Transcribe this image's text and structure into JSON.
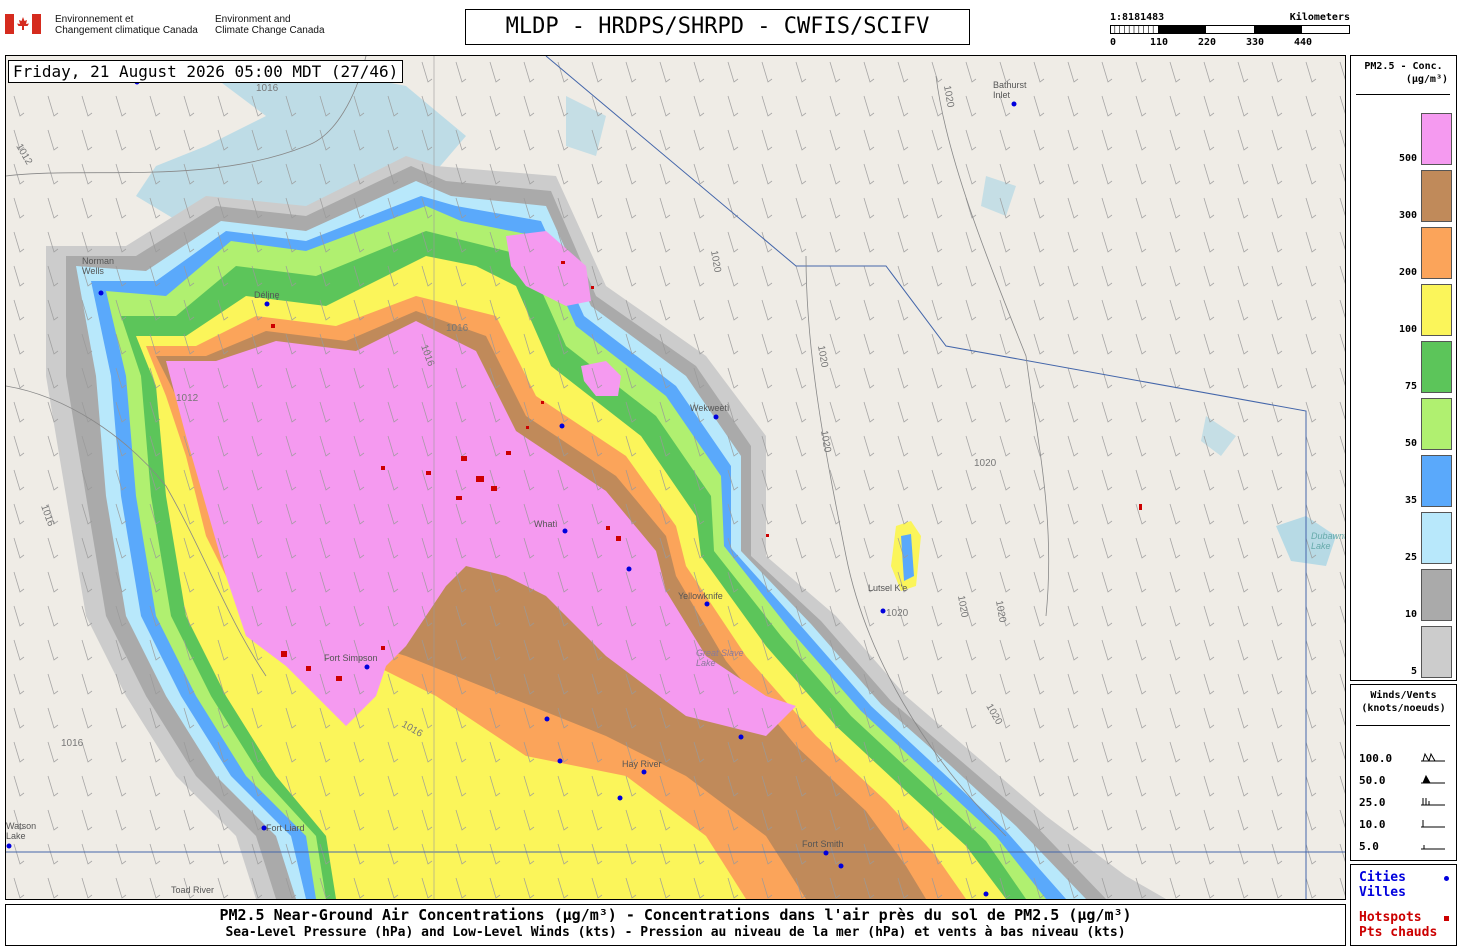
{
  "header": {
    "agency_fr_line1": "Environnement et",
    "agency_fr_line2": "Changement climatique Canada",
    "agency_en_line1": "Environment and",
    "agency_en_line2": "Climate Change Canada",
    "title": "MLDP - HRDPS/SHRPD - CWFIS/SCIFV"
  },
  "scale": {
    "ratio": "1:8181483",
    "unit": "Kilometers",
    "ticks": [
      "0",
      "110",
      "220",
      "330",
      "440"
    ]
  },
  "map": {
    "datetime": "Friday, 21 August 2026 05:00 MDT (27/46)",
    "places": [
      "Bathurst Inlet",
      "Norman Wells",
      "Délįnę",
      "Wekweètì",
      "Whatì",
      "Yellowknife",
      "Lutsel K'e",
      "Fort Simpson",
      "Hay River",
      "Fort Liard",
      "Fort Smith",
      "Toad River",
      "Watson Lake",
      "Great Slave Lake",
      "Dubawnt Lake"
    ],
    "isobars": [
      "1016",
      "1012",
      "1012",
      "1016",
      "1016",
      "1016",
      "1016",
      "1016",
      "1020",
      "1020",
      "1020",
      "1020",
      "1020",
      "1020",
      "1020",
      "1020",
      "1020"
    ]
  },
  "legend": {
    "title_line1": "PM2.5 - Conc.",
    "title_line2": "(µg/m³)",
    "levels": [
      {
        "label": "500",
        "color": "#f59af0"
      },
      {
        "label": "300",
        "color": "#c08a5a"
      },
      {
        "label": "200",
        "color": "#fba45a"
      },
      {
        "label": "100",
        "color": "#fbf55a"
      },
      {
        "label": "75",
        "color": "#5cc55a"
      },
      {
        "label": "50",
        "color": "#b0f070"
      },
      {
        "label": "35",
        "color": "#5aa9fb"
      },
      {
        "label": "25",
        "color": "#b8e8fb"
      },
      {
        "label": "10",
        "color": "#aaaaaa"
      },
      {
        "label": "5",
        "color": "#cccccc"
      }
    ]
  },
  "winds": {
    "title_line1": "Winds/Vents",
    "title_line2": "(knots/noeuds)",
    "speeds": [
      "100.0",
      "50.0",
      "25.0",
      "10.0",
      "5.0"
    ]
  },
  "markers": {
    "cities_en": "Cities",
    "cities_fr": "Villes",
    "hotspots_en": "Hotspots",
    "hotspots_fr": "Pts chauds",
    "city_color": "#0000dd",
    "hotspot_color": "#cc0000"
  },
  "footer": {
    "line1": "PM2.5 Near-Ground Air Concentrations (µg/m³) - Concentrations dans l'air près du sol de PM2.5 (µg/m³)",
    "line2": "Sea-Level Pressure (hPa) and Low-Level Winds (kts) - Pression au niveau de la mer (hPa) et vents à bas niveau (kts)"
  }
}
